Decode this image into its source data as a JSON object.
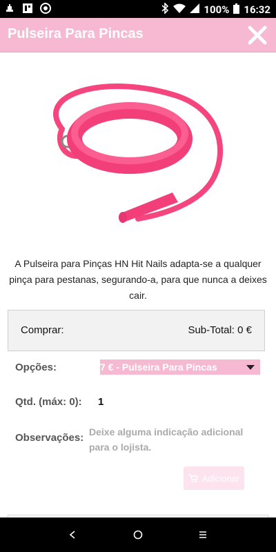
{
  "status_bar": {
    "battery": "100%",
    "time": "16:32",
    "icons": [
      "notification-icon",
      "whatsapp-icon",
      "app-icon",
      "bluetooth-icon",
      "wifi-icon",
      "signal-icon",
      "battery-icon"
    ]
  },
  "header": {
    "title": "Pulseira Para Pincas",
    "close_icon": "close-icon",
    "color": "#f7b8d2"
  },
  "product": {
    "image_alt": "pink silicone bracelet with lanyard",
    "description": "A Pulseira para Pinças HN Hit Nails adapta-se a qualquer pinça para pestanas, segurando-a, para que nunca a deixes cair."
  },
  "buy_box": {
    "label": "Comprar:",
    "subtotal": "Sub-Total: 0 €"
  },
  "form": {
    "options_label": "Opções:",
    "options_selected": "7 € - Pulseira Para Pincas",
    "qty_label": "Qtd. (máx: 0):",
    "qty_value": "1",
    "notes_label": "Observações:",
    "notes_placeholder": "Deixe alguma indicação adicional para o lojista.",
    "add_button": "Adicionar"
  },
  "nav_bar": {
    "back": "back-icon",
    "home": "home-icon",
    "recents": "recents-icon"
  },
  "colors": {
    "accent": "#f7b8d2",
    "button_disabled": "#fce3ee"
  }
}
